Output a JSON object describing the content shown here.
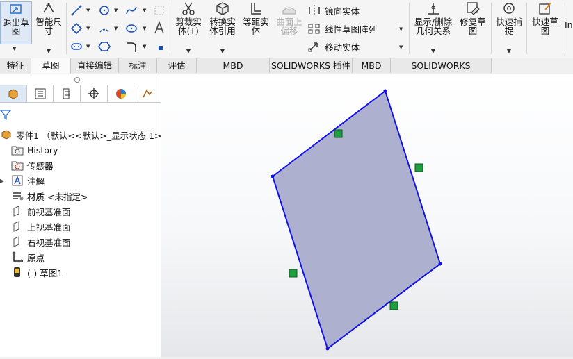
{
  "ribbon": {
    "exit_sketch": "退出草\n图",
    "smart_dimension": "智能尺\n寸",
    "trim_entities": "剪裁实\n体(T)",
    "convert_entities": "转换实\n体引用",
    "offset_entities": "等距实\n体",
    "offset_on_surface": "曲面上\n偏移",
    "mirror_entities": "镜向实体",
    "linear_pattern": "线性草图阵列",
    "move_entities": "移动实体",
    "display_relations": "显示/删除\n几何关系",
    "repair_sketch": "修复草\n图",
    "quick_snaps": "快速捕\n捉",
    "rapid_sketch": "快速草\n图",
    "overflow": "In"
  },
  "tabs": [
    {
      "label": "特征"
    },
    {
      "label": "草图"
    },
    {
      "label": "直接编辑"
    },
    {
      "label": "标注"
    },
    {
      "label": "评估"
    },
    {
      "label": "MBD Dimensions"
    },
    {
      "label": "SOLIDWORKS 插件"
    },
    {
      "label": "MBD"
    },
    {
      "label": "SOLIDWORKS Inspection"
    }
  ],
  "tree": {
    "root": "零件1 （默认<<默认>_显示状态 1>）",
    "items": [
      {
        "label": "History"
      },
      {
        "label": "传感器"
      },
      {
        "label": "注解"
      },
      {
        "label": "材质 <未指定>"
      },
      {
        "label": "前视基准面"
      },
      {
        "label": "上视基准面"
      },
      {
        "label": "右视基准面"
      },
      {
        "label": "原点"
      },
      {
        "label": "(-) 草图1"
      }
    ]
  },
  "colors": {
    "sketch_fill": "#aeb0d0",
    "sketch_line": "#1010e8",
    "relation_marker": "#1f9e3f"
  }
}
